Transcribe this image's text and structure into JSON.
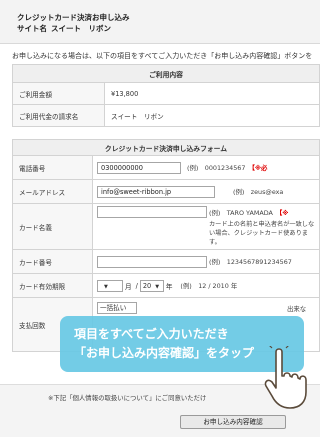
{
  "header": {
    "title_line1": "クレジットカード決済お申し込み",
    "site_label": "サイト名",
    "site_name": "スイート　リボン"
  },
  "intro_text": "お申し込みになる場合は、以下の項目をすべてご入力いただき「お申し込み内容確認」ボタンを",
  "usage_table": {
    "heading": "ご利用内容",
    "rows": [
      {
        "label": "ご利用金額",
        "value": "¥13,800"
      },
      {
        "label": "ご利用代金の請求名",
        "value": "スイート　リボン"
      }
    ]
  },
  "form": {
    "heading": "クレジットカード決済申し込みフォーム",
    "required_mark": "【※必",
    "phone": {
      "label": "電話番号",
      "value": "0300000000",
      "example": "(例)　0001234567"
    },
    "email": {
      "label": "メールアドレス",
      "value": "info@sweet-ribbon.jp",
      "example": "(例)　zeus@exa"
    },
    "card_name": {
      "label": "カード名義",
      "value": "",
      "example": "(例)　TARO YAMADA",
      "required_short": "【※",
      "note": "カード上の名前と申込者名が一致しない場合、クレジットカード使あります。"
    },
    "card_number": {
      "label": "カード番号",
      "value": "",
      "example": "(例)　1234567891234567"
    },
    "expiry": {
      "label": "カード有効期限",
      "month": "月",
      "sep": "/",
      "year_value": "20",
      "year": "年",
      "example": "(例)　12 / 2010 年"
    },
    "payment": {
      "label": "支払回数",
      "select_value": "一括払い",
      "right_note": "出来な"
    }
  },
  "callout": {
    "line1": "項目をすべてご入力いただき",
    "line2": "「お申し込み内容確認」をタップ"
  },
  "bottom": {
    "notice": "※下記「個人情報の取扱いについて」にご同意いただけ",
    "submit_label": "お申し込み内容確認"
  },
  "colors": {
    "callout": "#68c8e4",
    "required": "#e00000"
  }
}
